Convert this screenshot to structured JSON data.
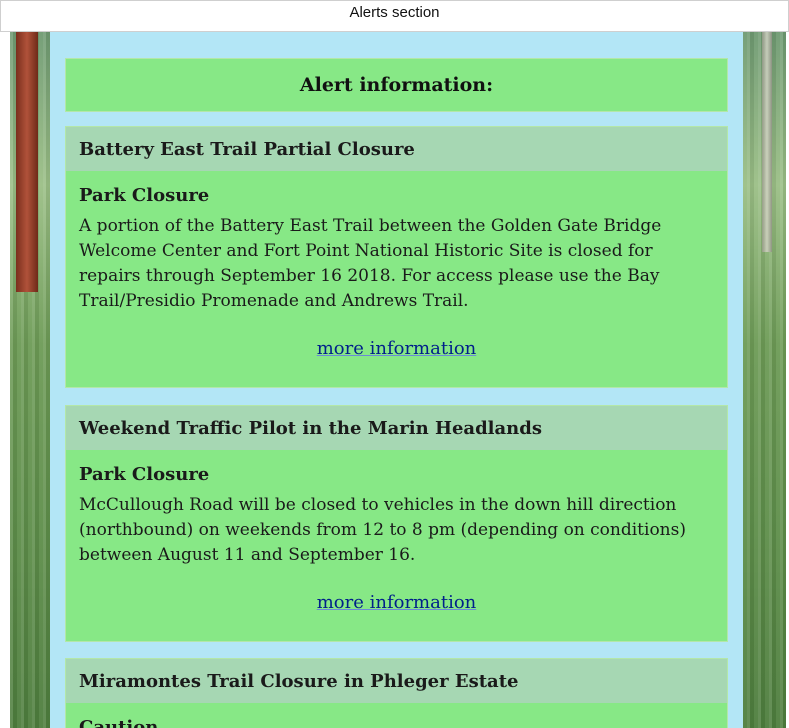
{
  "window": {
    "title": "Alerts section"
  },
  "header": {
    "title": "Alert information:"
  },
  "alerts": [
    {
      "title": "Battery East Trail Partial Closure",
      "type": "Park Closure",
      "description": "A portion of the Battery East Trail between the Golden Gate Bridge Welcome Center and Fort Point National Historic Site is closed for repairs through September 16 2018. For access please use the Bay Trail/Presidio Promenade and Andrews Trail.",
      "link": "more information"
    },
    {
      "title": "Weekend Traffic Pilot in the Marin Headlands",
      "type": "Park Closure",
      "description": "McCullough Road will be closed to vehicles in the down hill direction (northbound) on weekends from 12 to 8 pm (depending on conditions) between August 11 and September 16.",
      "link": "more information"
    },
    {
      "title": "Miramontes Trail Closure in Phleger Estate",
      "type": "Caution",
      "description": "",
      "link": ""
    }
  ],
  "colors": {
    "panel": "#b3e6f6",
    "card": "#87e886",
    "card_header": "#a6d7b3",
    "link": "#001f8a"
  }
}
